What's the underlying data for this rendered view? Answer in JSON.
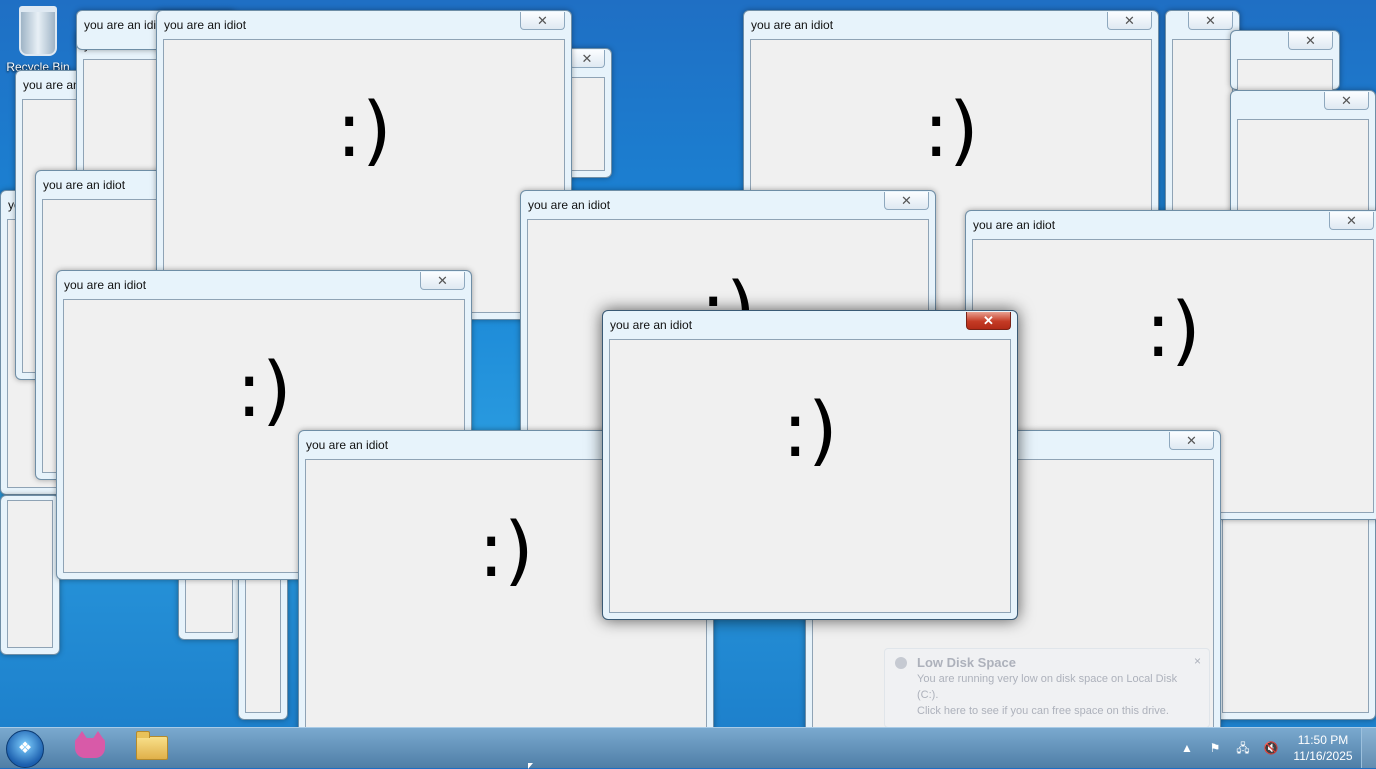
{
  "desktop": {
    "recycle_bin_label": "Recycle Bin"
  },
  "popup": {
    "title": "you are an idiot",
    "face": ":)",
    "close_glyph": "✕"
  },
  "notification": {
    "title": "Low Disk Space",
    "line1": "You are running very low on disk space on Local Disk (C:).",
    "line2": "Click here to see if you can free space on this drive.",
    "close_glyph": "×"
  },
  "taskbar": {
    "start_glyph": "❖",
    "apps": [
      "cat-app-icon",
      "folder-icon"
    ],
    "tray": {
      "overflow_glyph": "▲",
      "flag_glyph": "⚑",
      "network_glyph": "🖧",
      "volume_glyph": "🔇"
    },
    "clock": {
      "time": "11:50 PM",
      "date": "11/16/2025"
    }
  }
}
